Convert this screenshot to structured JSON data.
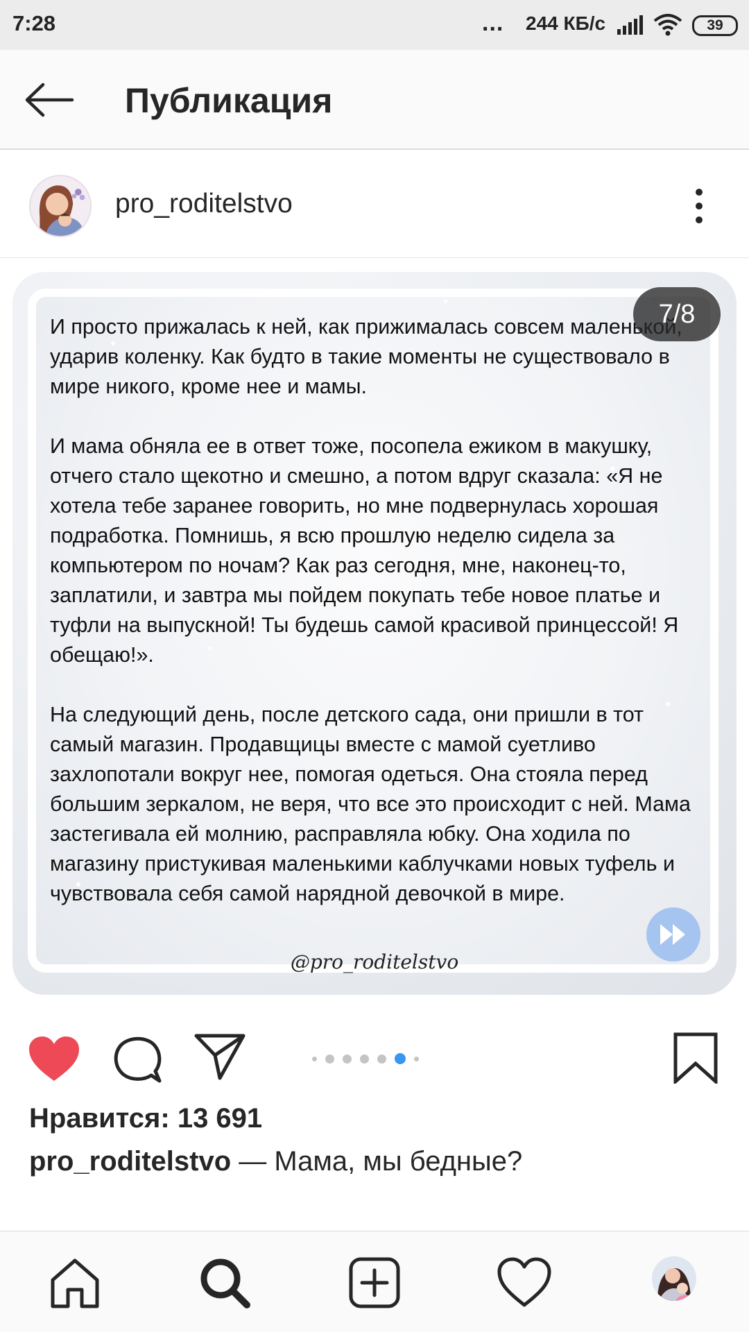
{
  "status_bar": {
    "time": "7:28",
    "dots": "...",
    "speed": "244 КБ/с",
    "battery": "39"
  },
  "app_bar": {
    "title": "Публикация"
  },
  "post": {
    "username": "pro_roditelstvo",
    "page_counter": "7/8",
    "paragraphs": [
      "И просто прижалась к ней, как прижималась совсем маленькой, ударив коленку. Как будто в такие моменты не существовало в мире никого, кроме нее и мамы.",
      "И мама обняла ее в ответ тоже, посопела ежиком в макушку, отчего стало щекотно и смешно, а потом вдруг сказала: «Я не хотела тебе заранее говорить, но мне подвернулась хорошая подработка. Помнишь, я всю прошлую неделю сидела за компьютером по ночам? Как раз сегодня, мне, наконец-то, заплатили, и завтра мы пойдем покупать тебе новое платье и туфли на выпускной! Ты будешь самой красивой принцессой! Я обещаю!».",
      "На следующий день, после детского сада, они пришли в тот самый магазин. Продавщицы вместе с мамой суетливо захлопотали вокруг нее, помогая одеться. Она стояла перед большим зеркалом, не веря, что все это происходит с ней. Мама застегивала ей молнию, расправляла юбку. Она ходила по магазину пристукивая маленькими каблучками новых туфель и чувствовала себя самой нарядной девочкой в мире."
    ],
    "watermark": "@pro_roditelstvo",
    "likes": "Нравится: 13 691",
    "caption_user": "pro_roditelstvo",
    "caption_text": " — Мама, мы бедные?"
  },
  "colors": {
    "like_red": "#ed4956",
    "active_dot": "#3897f0",
    "next_button": "#a6c4f0"
  },
  "icons": {
    "back": "arrow-left-icon",
    "more": "more-vertical-icon",
    "like": "heart-filled-icon",
    "comment": "comment-icon",
    "share": "send-icon",
    "bookmark": "bookmark-icon",
    "nav": [
      "home-icon",
      "search-icon",
      "add-post-icon",
      "activity-heart-icon",
      "profile-avatar"
    ]
  }
}
